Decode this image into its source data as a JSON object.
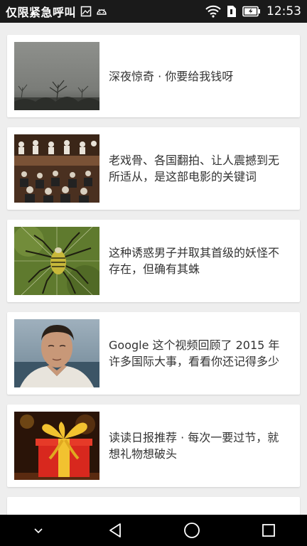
{
  "status_bar": {
    "carrier": "仅限紧急呼叫",
    "time": "12:53",
    "icons": [
      "screenshot-icon",
      "android-icon",
      "wifi-icon",
      "sim-icon",
      "battery-icon"
    ]
  },
  "feed": {
    "items": [
      {
        "title": "深夜惊奇 · 你要给我钱呀",
        "thumb": "foggy-trees-image"
      },
      {
        "title": "老戏骨、各国翻拍、让人震撼到无所适从，是这部电影的关键词",
        "thumb": "courtroom-crowd-image"
      },
      {
        "title": "这种诱惑男子并取其首级的妖怪不存在，但确有其蛛",
        "thumb": "spider-image"
      },
      {
        "title": "Google 这个视频回顾了 2015 年许多国际大事，看看你还记得多少",
        "thumb": "man-portrait-image"
      },
      {
        "title": "读读日报推荐 · 每次一要过节，就想礼物想破头",
        "thumb": "gift-box-image"
      }
    ]
  },
  "nav_bar": {
    "icons": [
      "hide-keyboard-icon",
      "back-icon",
      "home-icon",
      "recents-icon"
    ]
  }
}
